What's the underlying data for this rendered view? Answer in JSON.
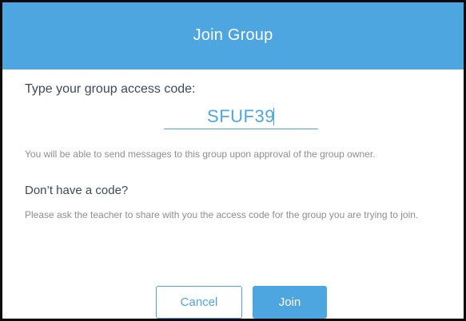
{
  "dialog": {
    "title": "Join Group"
  },
  "access_code": {
    "label": "Type your group access code:",
    "value": "SFUF39"
  },
  "approval_note": "You will be able to send messages to this group upon approval of the group owner.",
  "no_code": {
    "title": "Don’t have a code?",
    "text": "Please ask the teacher to share with you the access code for the group you are trying to join."
  },
  "buttons": {
    "cancel": "Cancel",
    "join": "Join"
  },
  "colors": {
    "accent": "#4da6e0",
    "heading_text": "#3b4a5a",
    "muted_text": "#8a8f94"
  }
}
